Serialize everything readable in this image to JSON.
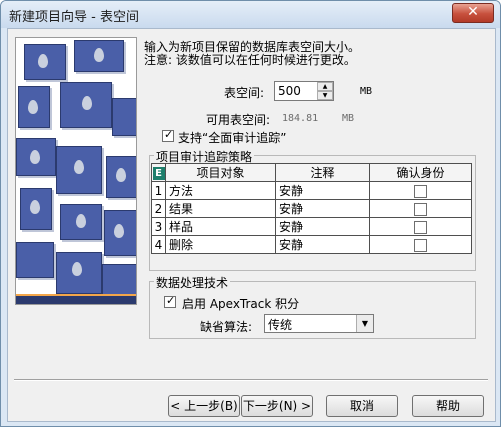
{
  "window": {
    "title": "新建项目向导 - 表空间",
    "close_icon": "close-icon"
  },
  "intro": {
    "line1": "输入为新项目保留的数据库表空间大小。",
    "line2": "注意: 该数值可以在任何时候进行更改。"
  },
  "tablespace": {
    "label": "表空间:",
    "value": "500",
    "unit": "MB",
    "available_label": "可用表空间:",
    "available_value": "184.81",
    "available_unit": "MB"
  },
  "audit": {
    "checkbox_label": "支持“全面审计追踪”",
    "checked": true,
    "group_title": "项目审计追踪策略",
    "table": {
      "corner_icon": "E",
      "headers": [
        "项目对象",
        "注释",
        "确认身份"
      ],
      "rows": [
        {
          "index": "1",
          "object": "方法",
          "note": "安静",
          "confirm": false
        },
        {
          "index": "2",
          "object": "结果",
          "note": "安静",
          "confirm": false
        },
        {
          "index": "3",
          "object": "样品",
          "note": "安静",
          "confirm": false
        },
        {
          "index": "4",
          "object": "删除",
          "note": "安静",
          "confirm": false
        }
      ]
    }
  },
  "processing": {
    "group_title": "数据处理技术",
    "apextrack_label": "启用 ApexTrack 积分",
    "apextrack_checked": true,
    "algorithm_label": "缺省算法:",
    "algorithm_value": "传统"
  },
  "buttons": {
    "back": "< 上一步(B)",
    "next": "下一步(N) >",
    "cancel": "取消",
    "help": "帮助"
  }
}
